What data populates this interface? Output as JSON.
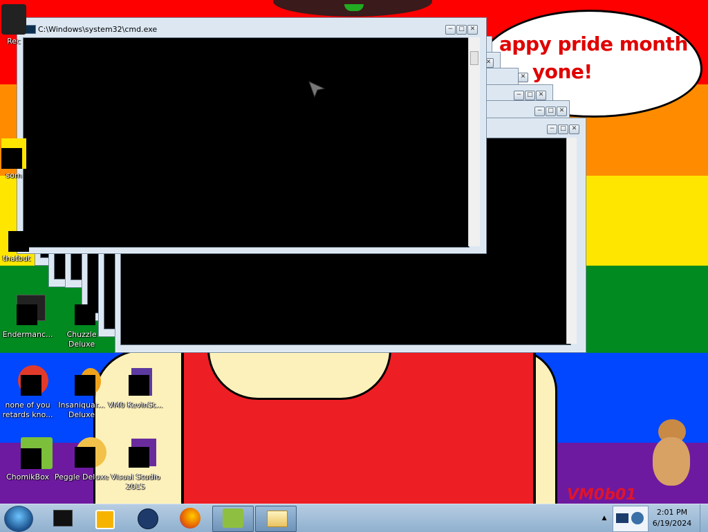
{
  "desktop": {
    "speech_bubble": [
      "appy pride month",
      "yone!"
    ],
    "watermark": "VM0b01"
  },
  "main_window": {
    "title": "C:\\Windows\\system32\\cmd.exe",
    "minimize": "−",
    "maximize": "□",
    "close": "✕"
  },
  "icons": [
    {
      "label": "Rec"
    },
    {
      "label": "som"
    },
    {
      "label": "thatbut"
    },
    {
      "label": "Endermanc..."
    },
    {
      "label": "Chuzzle Deluxe"
    },
    {
      "label": "none of you retards kno..."
    },
    {
      "label": "Insaniquar... Deluxe"
    },
    {
      "label": "VM0 KevinSt..."
    },
    {
      "label": "ChomikBox"
    },
    {
      "label": "Peggle Deluxe"
    },
    {
      "label": "Visual Studio 2015"
    }
  ],
  "taskbar": {
    "time": "2:01 PM",
    "date": "6/19/2024",
    "show_hidden": "▲"
  },
  "colors": {
    "red": "#ff0000",
    "orange": "#ff8c00",
    "yellow": "#ffe600",
    "green": "#008a1f",
    "blue": "#0047ff",
    "purple": "#6d1aa0"
  }
}
